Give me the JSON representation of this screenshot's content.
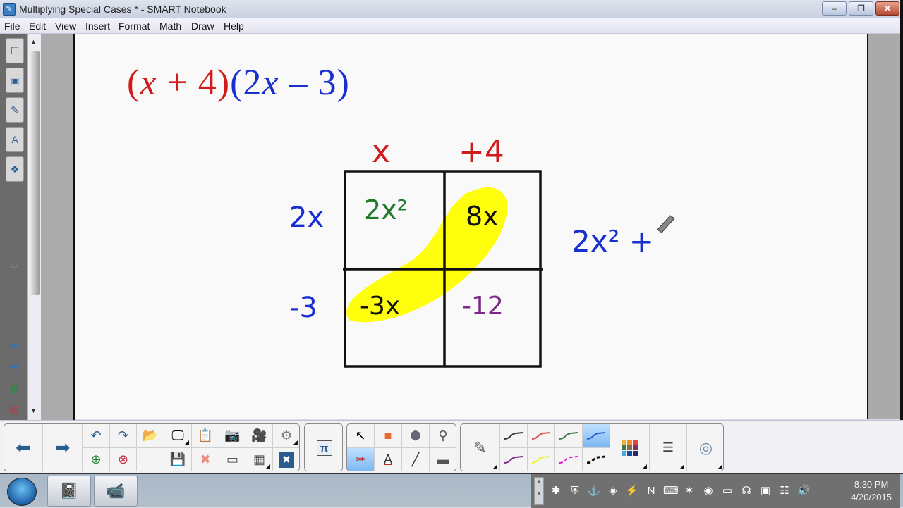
{
  "window": {
    "title": "Multiplying Special Cases * - SMART Notebook",
    "app_icon": "smart-notebook-icon",
    "controls": {
      "minimize": "–",
      "restore": "❐",
      "close": "✕"
    }
  },
  "menu": [
    "File",
    "Edit",
    "View",
    "Insert",
    "Format",
    "Math",
    "Draw",
    "Help"
  ],
  "side_tabs": [
    {
      "icon": "page-sorter-icon",
      "glyph": "☐"
    },
    {
      "icon": "gallery-icon",
      "glyph": "▣"
    },
    {
      "icon": "attachments-icon",
      "glyph": "✎"
    },
    {
      "icon": "properties-icon",
      "glyph": "A"
    },
    {
      "icon": "addons-icon",
      "glyph": "❖"
    }
  ],
  "side_nav": [
    {
      "icon": "previous-page-icon",
      "glyph": "⬅"
    },
    {
      "icon": "next-page-icon",
      "glyph": "➡"
    },
    {
      "icon": "add-page-icon",
      "glyph": "⊕"
    },
    {
      "icon": "delete-page-icon",
      "glyph": "⊗"
    }
  ],
  "canvas": {
    "equation": {
      "part1": "(x + 4)",
      "open1": "(",
      "x1": "x",
      "plus": " + 4",
      "close1": ")",
      "open2": "(",
      "two": "2",
      "x2": "x",
      "minus": " – 3",
      "close2": ")"
    },
    "column_headers": [
      "x",
      "+4"
    ],
    "row_headers": [
      "2x",
      "-3"
    ],
    "cells": [
      {
        "text": "2x²",
        "color": "#1f7a2a"
      },
      {
        "text": "8x",
        "color": "#111111"
      },
      {
        "text": "-3x",
        "color": "#111111"
      },
      {
        "text": "-12",
        "color": "#7a2a86"
      }
    ],
    "highlight_color": "#ffff00",
    "result_partial": "2x² +",
    "colors": {
      "red": "#d11b1b",
      "blue": "#1a2fd0",
      "grid": "#111111"
    }
  },
  "toolbar": {
    "nav": [
      {
        "name": "previous-page-button",
        "glyph": "⬅"
      },
      {
        "name": "next-page-button",
        "glyph": "➡"
      }
    ],
    "file_row1": [
      {
        "name": "undo-button",
        "glyph": "↶"
      },
      {
        "name": "redo-button",
        "glyph": "↷"
      },
      {
        "name": "open-file-button",
        "glyph": "📂"
      },
      {
        "name": "screen-shade-button",
        "glyph": "🖵"
      },
      {
        "name": "paste-button",
        "glyph": "📋"
      },
      {
        "name": "screen-capture-button",
        "glyph": "📷"
      },
      {
        "name": "document-camera-button",
        "glyph": "🎥"
      },
      {
        "name": "response-button",
        "glyph": "⚙"
      }
    ],
    "file_row2": [
      {
        "name": "add-page-button",
        "glyph": "⊕"
      },
      {
        "name": "delete-page-button",
        "glyph": "⊗"
      },
      {
        "name": "blank-slot",
        "glyph": ""
      },
      {
        "name": "save-button",
        "glyph": "💾"
      },
      {
        "name": "delete-button",
        "glyph": "✖"
      },
      {
        "name": "full-screen-button",
        "glyph": "▭"
      },
      {
        "name": "insert-table-button",
        "glyph": "▦"
      },
      {
        "name": "close-toolbar-button",
        "glyph": "✖"
      }
    ],
    "math_button": "π",
    "tools_row1": [
      {
        "name": "select-tool",
        "glyph": "↖"
      },
      {
        "name": "shapes-tool",
        "glyph": "■"
      },
      {
        "name": "regular-polygons-tool",
        "glyph": "⬢"
      },
      {
        "name": "fill-tool",
        "glyph": "⚲"
      }
    ],
    "tools_row2": [
      {
        "name": "pens-tool",
        "glyph": "✏"
      },
      {
        "name": "text-tool",
        "glyph": "A"
      },
      {
        "name": "lines-tool",
        "glyph": "╱"
      },
      {
        "name": "eraser-tool",
        "glyph": "▬"
      }
    ],
    "pen_button": "✎",
    "pen_styles_row1": [
      "#333333",
      "#e84b4b",
      "#3f7a4a",
      "#2a5fd0"
    ],
    "pen_styles_row2": [
      "#7a2a86",
      "#f5f03a",
      "#e01ad0",
      "#111111"
    ],
    "selected_pen_style": 3,
    "color_palette": [
      "#f3b12b",
      "#f28a2a",
      "#e04444",
      "#3a7a4a",
      "#8a6a4a",
      "#7a3060",
      "#4aa8e0",
      "#1a4a9a",
      "#2a2a6a"
    ],
    "line_props_glyph": "☰",
    "fill_effects_glyph": "◎"
  },
  "taskbar": {
    "apps": [
      {
        "name": "smart-notebook-taskbar-button",
        "glyph": "📓"
      },
      {
        "name": "document-camera-taskbar-button",
        "glyph": "📹"
      }
    ],
    "tray_icons": [
      "bluetooth-icon",
      "antivirus-icon",
      "network-share-icon",
      "adobe-icon",
      "power-icon",
      "onenote-icon",
      "keyboard-icon",
      "connection-icon",
      "burn-icon",
      "display-icon",
      "headset-icon",
      "monitor-icon",
      "network-icon",
      "volume-icon"
    ],
    "tray_glyphs": [
      "✱",
      "⛨",
      "⚓",
      "◈",
      "⚡",
      "N",
      "⌨",
      "✶",
      "◉",
      "▭",
      "☊",
      "▣",
      "☷",
      "🔊"
    ],
    "time": "8:30 PM",
    "date": "4/20/2015"
  }
}
